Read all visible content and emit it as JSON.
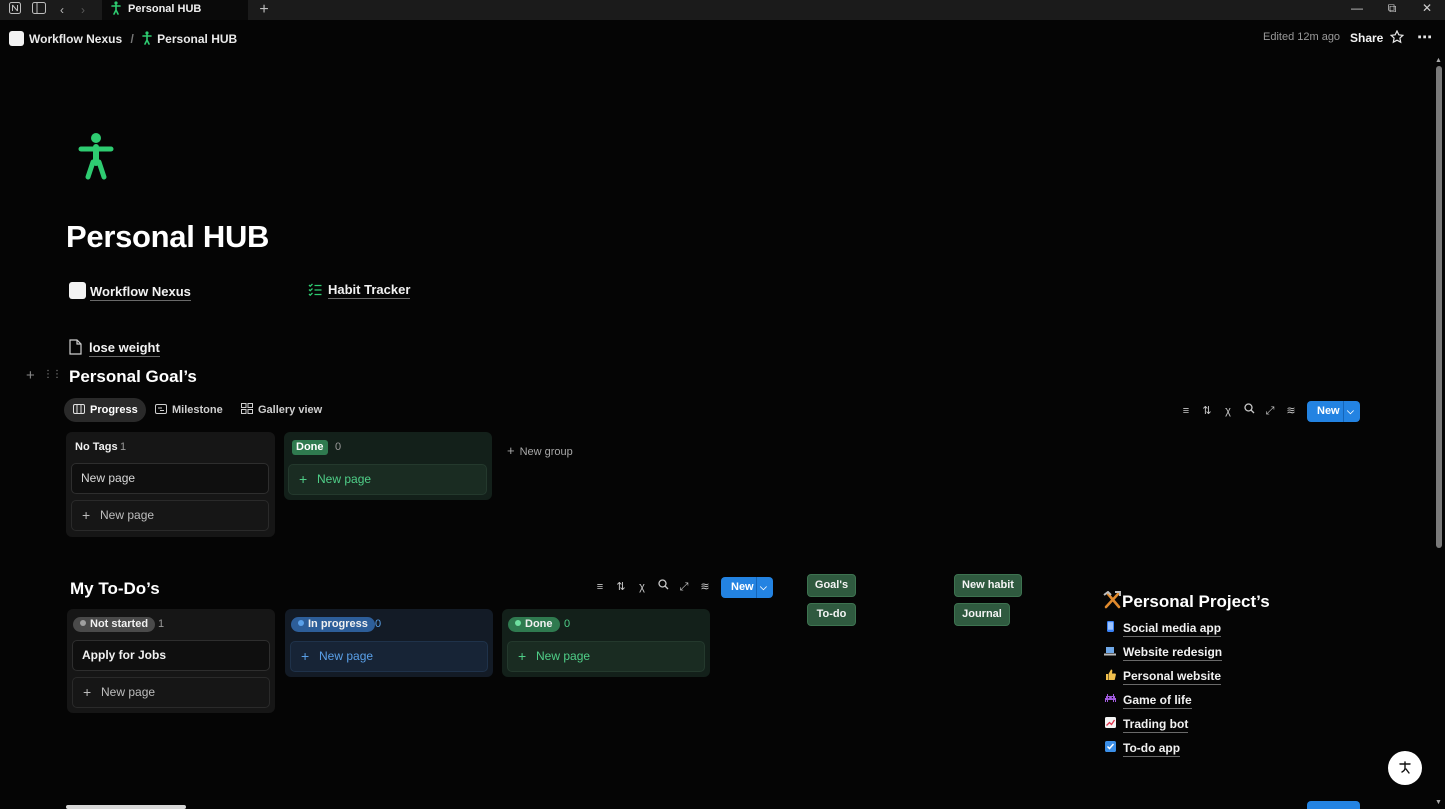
{
  "titlebar": {
    "tab_title": "Personal HUB",
    "new_tab_symbol": "+"
  },
  "topbar": {
    "breadcrumb_workspace": "Workflow Nexus",
    "breadcrumb_sep": "/",
    "breadcrumb_page": "Personal HUB",
    "edited": "Edited 12m ago",
    "share": "Share"
  },
  "page": {
    "title": "Personal HUB",
    "icon": "person-icon",
    "links": [
      {
        "label": "Workflow Nexus",
        "icon": "workspace-logo-icon"
      },
      {
        "label": "Habit Tracker",
        "icon": "checklist-icon"
      }
    ],
    "subpage": "lose weight"
  },
  "goals": {
    "heading": "Personal Goal’s",
    "views": [
      "Progress",
      "Milestone",
      "Gallery view"
    ],
    "new_button": "New",
    "columns": [
      {
        "label": "No Tags",
        "count": "1",
        "cards": [
          "New page"
        ],
        "add": "New page"
      },
      {
        "label": "Done",
        "count": "0",
        "cards": [],
        "add": "New page"
      }
    ],
    "new_group": "New group"
  },
  "todos": {
    "heading": "My To-Do’s",
    "new_button": "New",
    "columns": [
      {
        "label": "Not started",
        "count": "1",
        "cards": [
          "Apply for Jobs"
        ],
        "add": "New page"
      },
      {
        "label": "In progress",
        "count": "0",
        "cards": [],
        "add": "New page"
      },
      {
        "label": "Done",
        "count": "0",
        "cards": [],
        "add": "New page"
      }
    ]
  },
  "quick_buttons": [
    "Goal's",
    "To-do",
    "New habit",
    "Journal"
  ],
  "projects": {
    "heading": "Personal Project’s",
    "heading_icon": "hammer-pick-icon",
    "items": [
      {
        "label": "Social media app",
        "icon": "phone-icon"
      },
      {
        "label": "Website redesign",
        "icon": "laptop-icon"
      },
      {
        "label": "Personal website",
        "icon": "thumbs-up-icon"
      },
      {
        "label": "Game of life",
        "icon": "alien-icon"
      },
      {
        "label": "Trading bot",
        "icon": "chart-up-icon"
      },
      {
        "label": "To-do app",
        "icon": "checkbox-icon"
      }
    ]
  },
  "colors": {
    "background": "#050505",
    "accent_blue": "#2383e2",
    "green_icon": "#2ecc71",
    "green_button": "#2f5a3f"
  }
}
